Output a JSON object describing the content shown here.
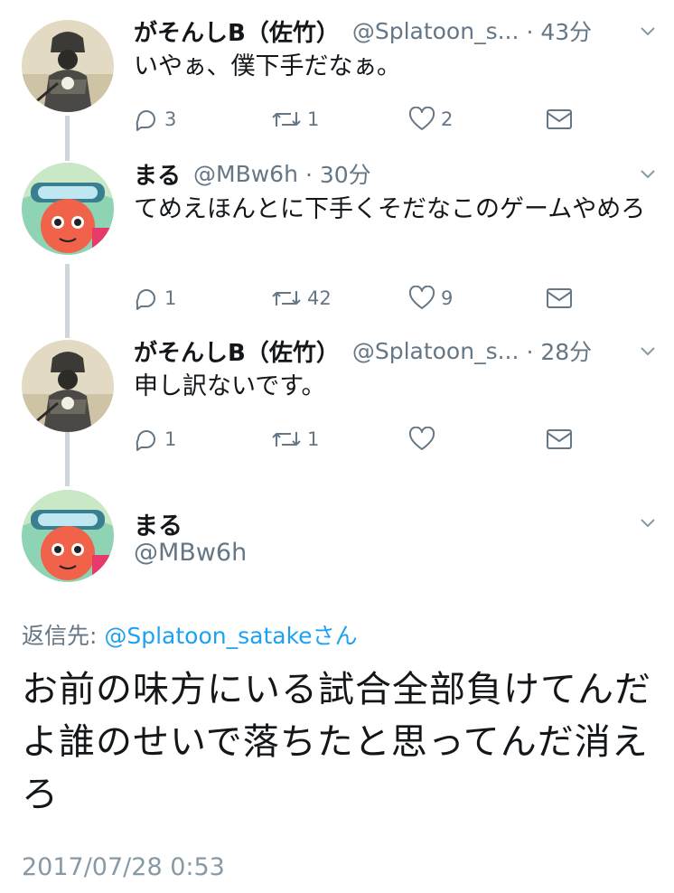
{
  "thread": [
    {
      "name": "がそんしB（佐竹）",
      "handle": "@Splatoon_s...",
      "time": "· 43分",
      "text": "いやぁ、僕下手だなぁ。",
      "replies": "3",
      "retweets": "1",
      "likes": "2"
    },
    {
      "name": "まる",
      "handle": "@MBw6h",
      "time": "· 30分",
      "text": "てめえほんとに下手くそだなこのゲームやめろ",
      "replies": "1",
      "retweets": "42",
      "likes": "9"
    },
    {
      "name": "がそんしB（佐竹）",
      "handle": "@Splatoon_s...",
      "time": "· 28分",
      "text": "申し訳ないです。",
      "replies": "1",
      "retweets": "1",
      "likes": ""
    }
  ],
  "main_tweet": {
    "name": "まる",
    "handle": "@MBw6h",
    "reply_label": "返信先: ",
    "reply_handle": "@Splatoon_satake",
    "reply_suffix": "さん",
    "text": "お前の味方にいる試合全部負けてんだよ誰のせいで落ちたと思ってんだ消えろ",
    "timestamp": "2017/07/28 0:53"
  },
  "colors": {
    "accent": "#1da1f2",
    "secondary_text": "#657786",
    "thread_line": "#cdd6dd"
  },
  "icons": [
    "reply-icon",
    "retweet-icon",
    "like-icon",
    "dm-icon",
    "chevron-down-icon"
  ]
}
